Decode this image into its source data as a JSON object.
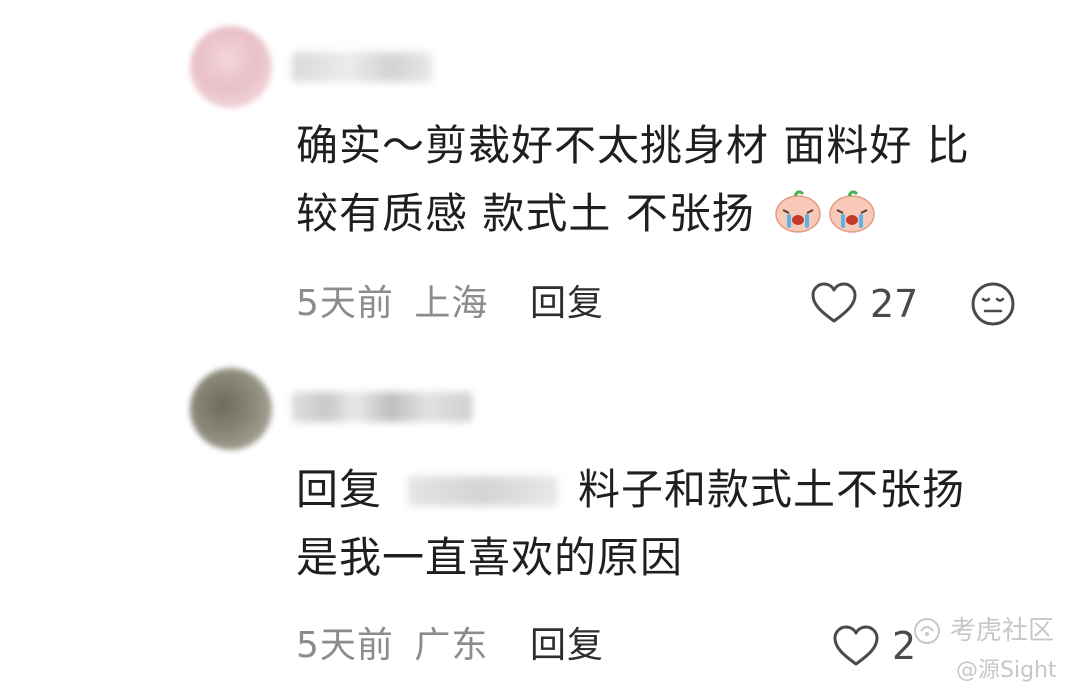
{
  "comments": [
    {
      "text_line1": "确实～剪裁好不太挑身材 面料好 比",
      "text_line2": "较有质感 款式土 不张扬",
      "time": "5天前",
      "location": "上海",
      "reply_label": "回复",
      "likes": "27",
      "emoji": "crying-face-emoji"
    },
    {
      "reply_prefix": "回复",
      "text_line1_rest": "料子和款式土不张扬",
      "text_line2": "是我一直喜欢的原因",
      "time": "5天前",
      "location": "广东",
      "reply_label": "回复",
      "likes": "2"
    }
  ],
  "watermark": {
    "line1": "考虎社区",
    "line2": "@源Sight"
  },
  "colors": {
    "text": "#1f1f1f",
    "meta": "#8c8c8c",
    "icon": "#4a4a4a",
    "watermark": "#c7c7c7"
  }
}
